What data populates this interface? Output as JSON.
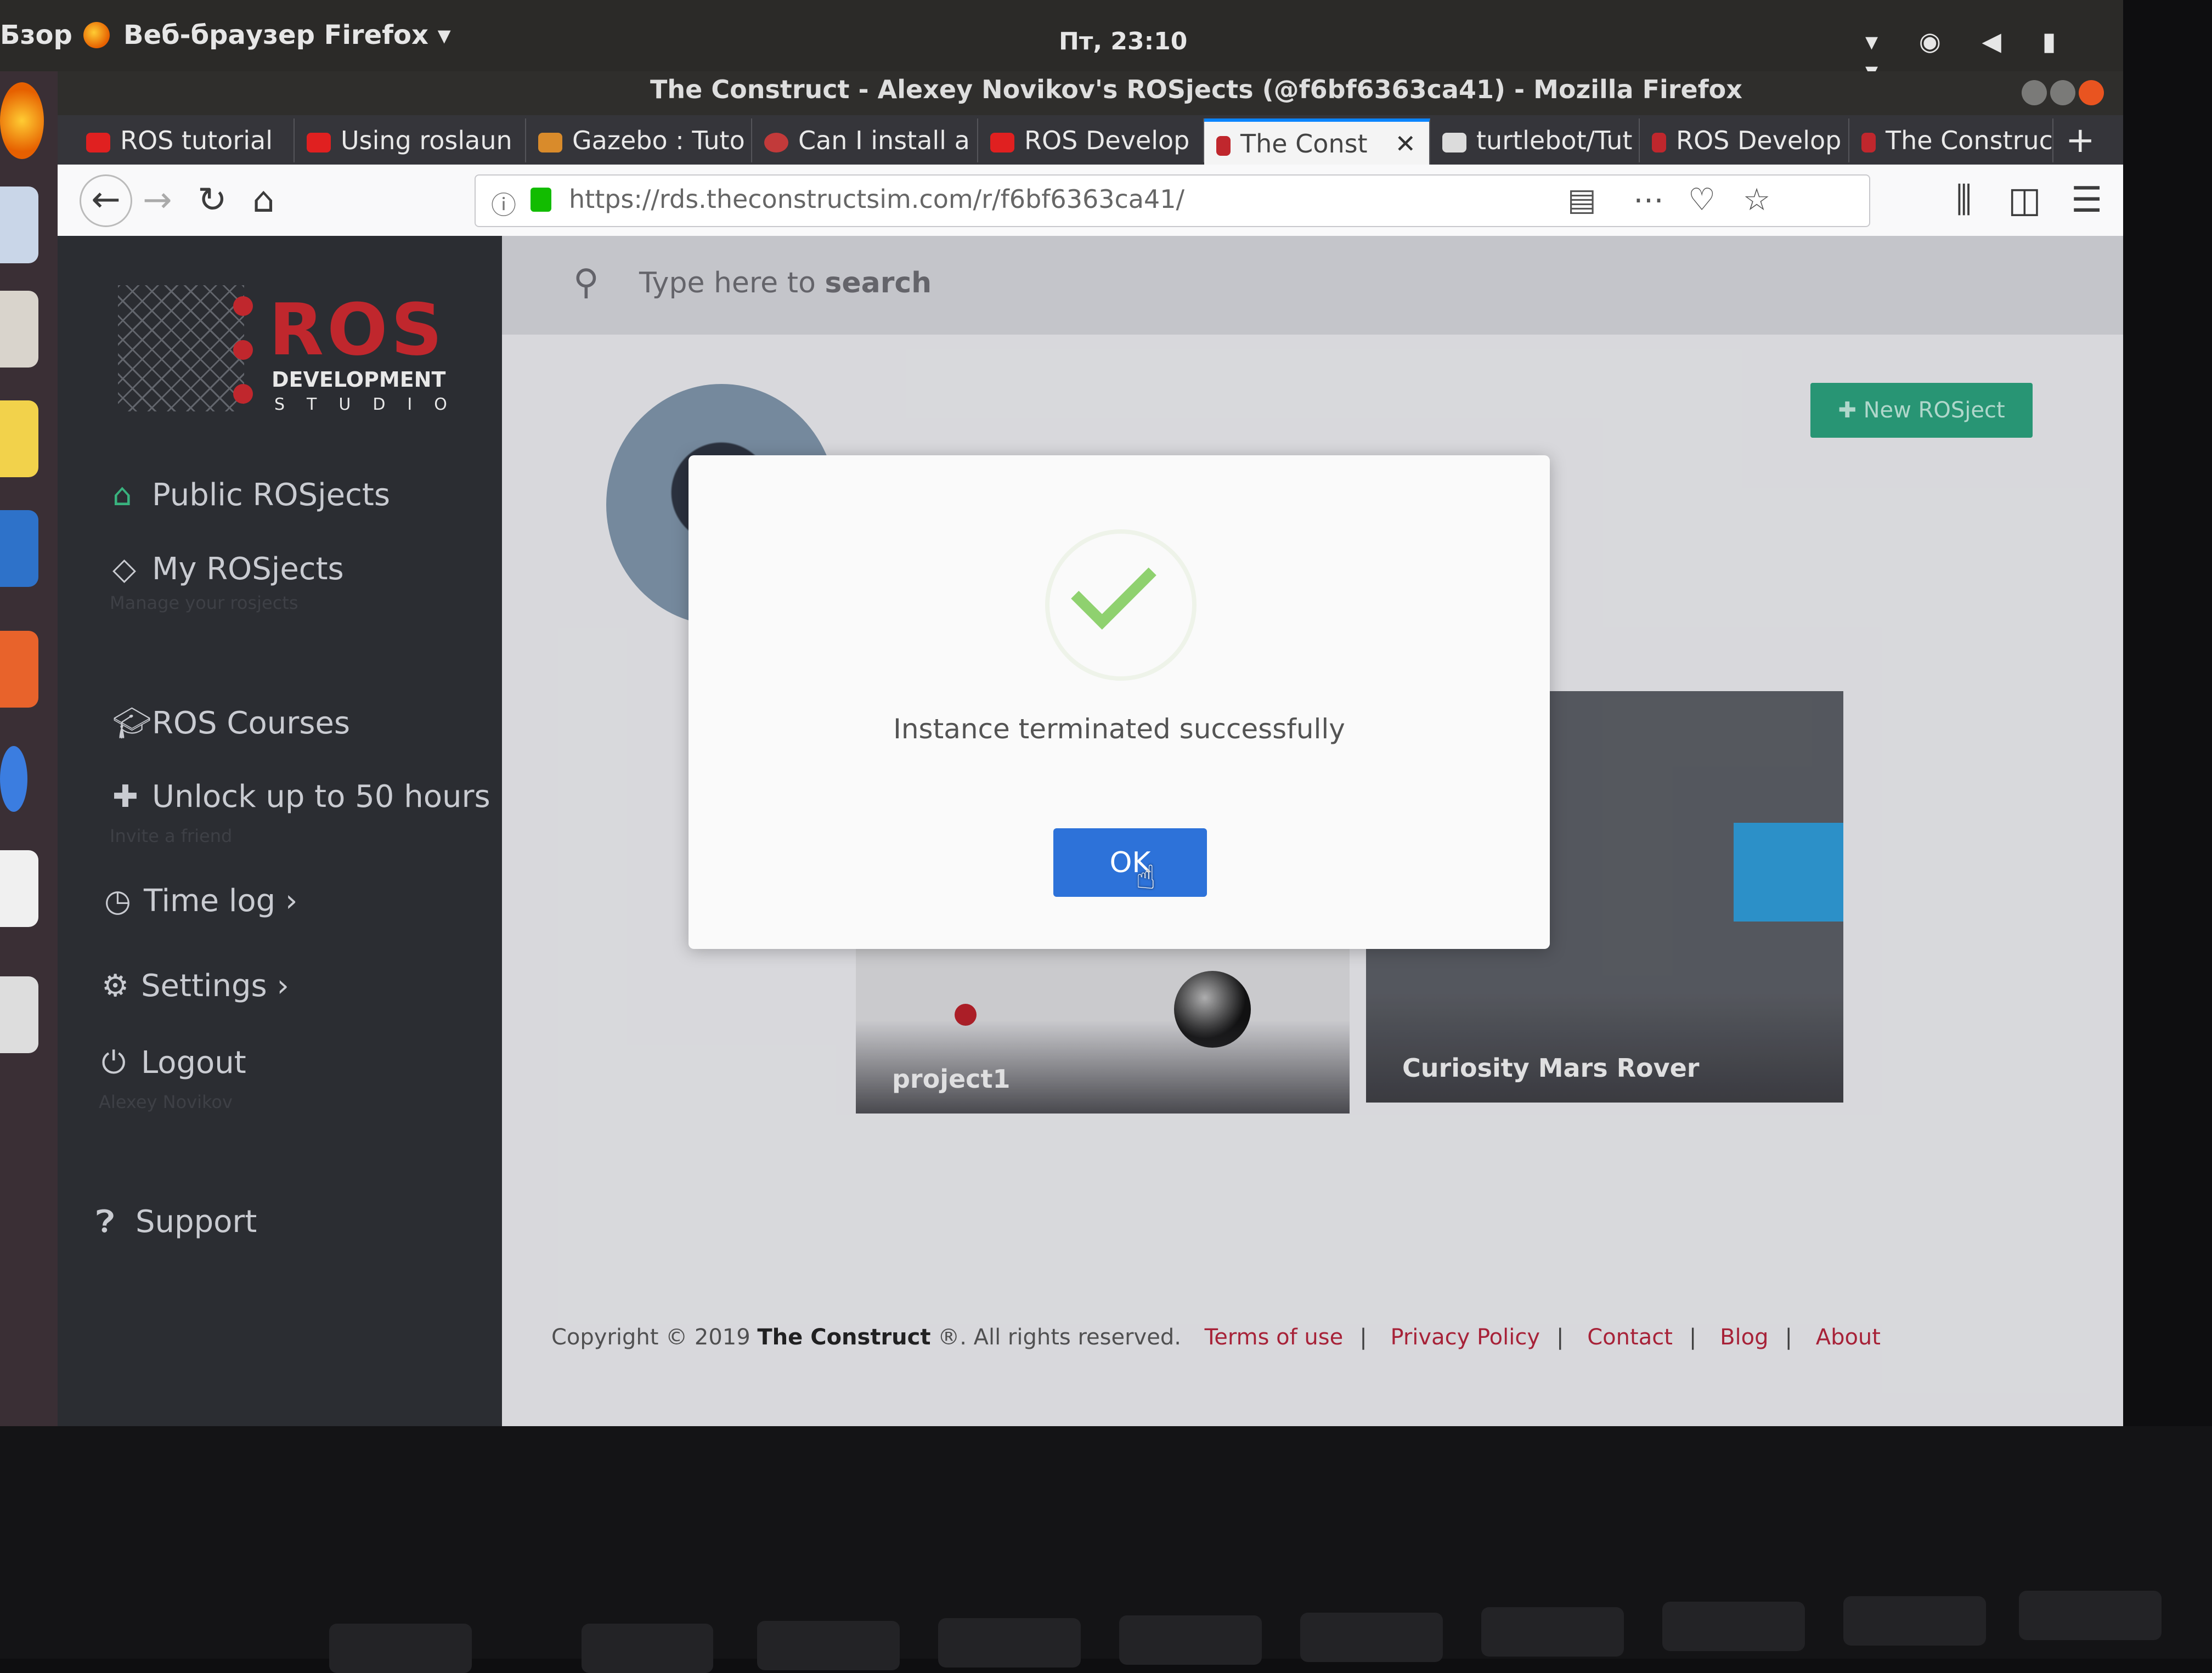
{
  "os": {
    "overview_label": "Бзор",
    "app_menu": "Веб-браузер Firefox",
    "clock": "Пт, 23:10"
  },
  "window": {
    "title": "The Construct - Alexey Novikov's ROSjects (@f6bf6363ca41) - Mozilla Firefox"
  },
  "tabs": [
    {
      "label": "ROS tutorial"
    },
    {
      "label": "Using roslaun"
    },
    {
      "label": "Gazebo : Tuto"
    },
    {
      "label": "Can I install a"
    },
    {
      "label": "ROS Develop"
    },
    {
      "label": "The Const",
      "active": true
    },
    {
      "label": "turtlebot/Tut"
    },
    {
      "label": "ROS Develop"
    },
    {
      "label": "The Construc"
    }
  ],
  "address_bar": {
    "url": "https://rds.theconstructsim.com/r/f6bf6363ca41/"
  },
  "brand": {
    "logo_main": "ROS",
    "logo_sub": "DEVELOPMENT",
    "logo_studio": "STUDIO",
    "accent": "#c0272d"
  },
  "sidebar": {
    "items": [
      {
        "label": "Public ROSjects",
        "icon": "home-icon"
      },
      {
        "label": "My ROSjects",
        "icon": "diamond-icon",
        "sub": "Manage your rosjects"
      },
      {
        "label": "ROS Courses",
        "icon": "graduation-cap-icon"
      },
      {
        "label": "Unlock up to 50 hours",
        "icon": "add-user-icon",
        "sub": "Invite a friend"
      },
      {
        "label": "Time log",
        "icon": "clock-icon"
      },
      {
        "label": "Settings",
        "icon": "gears-icon"
      },
      {
        "label": "Logout",
        "icon": "power-icon",
        "sub": "Alexey Novikov"
      },
      {
        "label": "Support",
        "icon": "question-icon"
      }
    ]
  },
  "search": {
    "placeholder_prefix": "Type here to ",
    "placeholder_bold": "search"
  },
  "new_rosject_button": "New ROSject",
  "cards": [
    {
      "label": "project1"
    },
    {
      "label": "Curiosity Mars Rover"
    }
  ],
  "modal": {
    "message": "Instance terminated successfully",
    "ok_label": "OK",
    "check_color": "#8fd16f",
    "button_color": "#2d72d9"
  },
  "footer": {
    "copyright_prefix": "Copyright © 2019 ",
    "company": "The Construct",
    "copyright_suffix": " ®. All rights reserved.",
    "links": [
      "Terms of use",
      "Privacy Policy",
      "Contact",
      "Blog",
      "About"
    ]
  }
}
